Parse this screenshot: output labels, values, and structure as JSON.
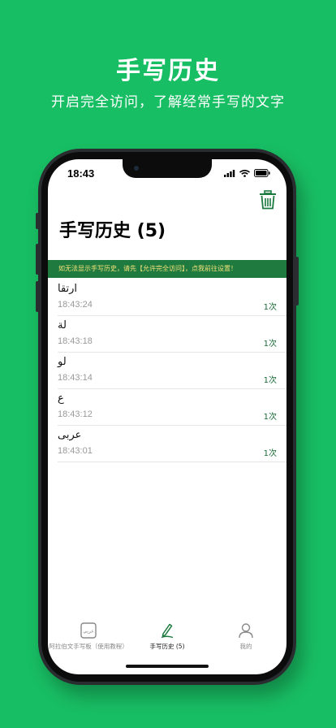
{
  "promo": {
    "title": "手写历史",
    "subtitle": "开启完全访问，了解经常手写的文字"
  },
  "status_bar": {
    "time": "18:43",
    "icons": [
      "signal-icon",
      "wifi-icon",
      "battery-icon"
    ]
  },
  "header": {
    "title": "手写历史 (5)",
    "trash_icon": "trash-icon"
  },
  "banner": {
    "text": "如无法显示手写历史，请先【允许完全访问】，点我前往设置！"
  },
  "history": [
    {
      "word": "ارتقا",
      "time": "18:43:24",
      "count": "1次"
    },
    {
      "word": "لة",
      "time": "18:43:18",
      "count": "1次"
    },
    {
      "word": "لو",
      "time": "18:43:14",
      "count": "1次"
    },
    {
      "word": "ع",
      "time": "18:43:12",
      "count": "1次"
    },
    {
      "word": "عربى",
      "time": "18:43:01",
      "count": "1次"
    }
  ],
  "tabbar": {
    "items": [
      {
        "label": "阿拉伯文手写板（使用教程）",
        "icon": "keyboard-icon",
        "icon_text": "عربي"
      },
      {
        "label": "手写历史 (5)",
        "icon": "pen-icon"
      },
      {
        "label": "我的",
        "icon": "person-icon"
      }
    ],
    "active_index": 1
  },
  "colors": {
    "background": "#18be63",
    "accent": "#1b6b38",
    "banner_bg": "#1f7a3f",
    "banner_text": "#f2e27a"
  }
}
